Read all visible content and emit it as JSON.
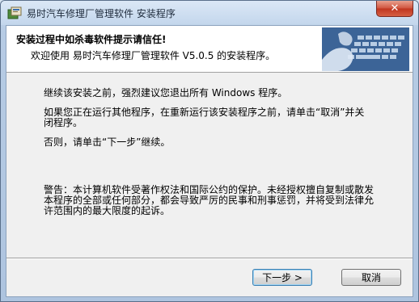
{
  "window": {
    "title": "易时汽车修理厂管理软件 安装程序",
    "close_label": "✕"
  },
  "header": {
    "title": "安装过程中如杀毒软件提示请信任!",
    "subtitle": "欢迎使用 易时汽车修理厂管理软件 V5.0.5 的安装程序。"
  },
  "body": {
    "paragraph1": "继续该安装之前，强烈建议您退出所有 Windows 程序。",
    "paragraph2_line1": "如果您正在运行其他程序，在重新运行该安装程序之前，请单击“取消”并关",
    "paragraph2_line2": "闭程序。",
    "paragraph3": "否则，请单击“下一步”继续。",
    "warning_line1": "警告：本计算机软件受著作权法和国际公约的保护。未经授权擅自复制或散发",
    "warning_line2": "本程序的全部或任何部分，都会导致严厉的民事和刑事惩罚，并将受到法律允",
    "warning_line3": "许范围内的最大限度的起诉。"
  },
  "buttons": {
    "next_label": "下一步 >",
    "cancel_label": "取消"
  }
}
